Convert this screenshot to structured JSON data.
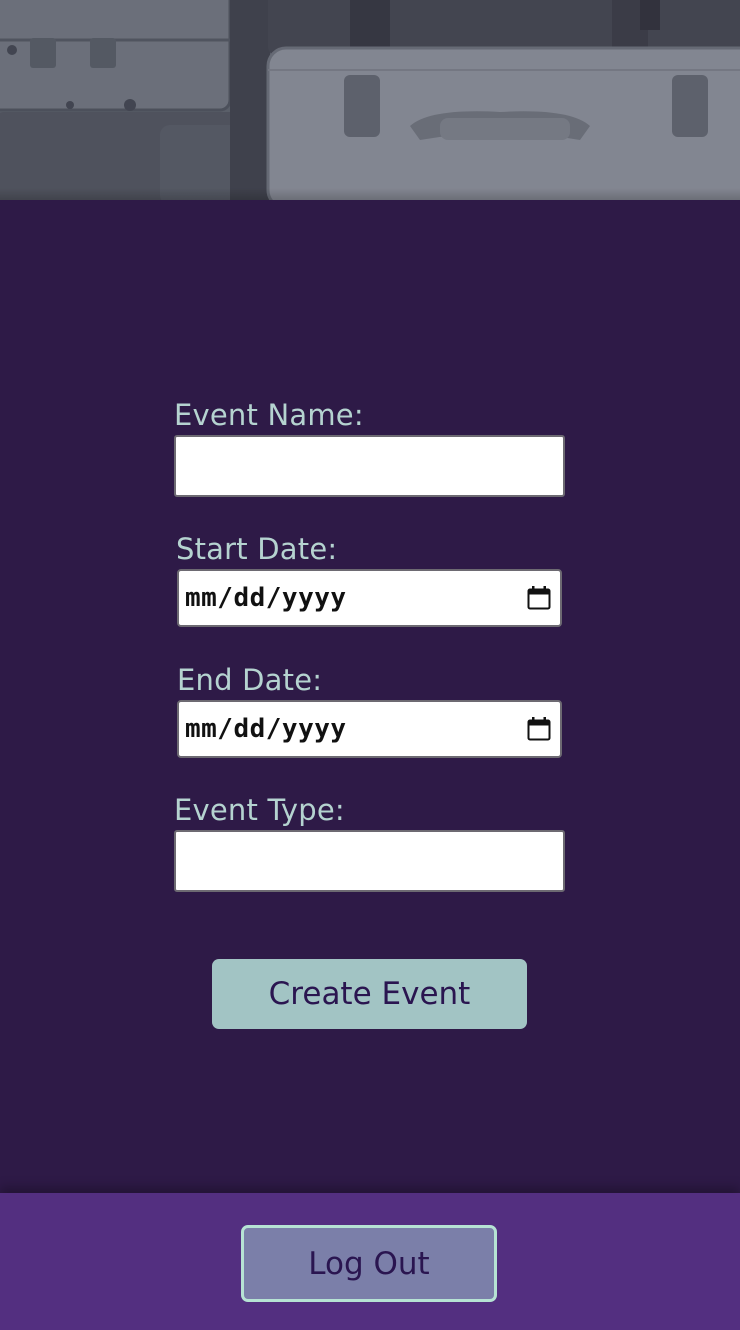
{
  "hero": {
    "image": "vintage-suitcases-photo"
  },
  "form": {
    "event_name": {
      "label": "Event Name:",
      "value": ""
    },
    "start_date": {
      "label": "Start Date:",
      "placeholder": "mm/dd/yyyy"
    },
    "end_date": {
      "label": "End Date:",
      "placeholder": "mm/dd/yyyy"
    },
    "event_type": {
      "label": "Event Type:",
      "value": ""
    },
    "submit_label": "Create Event"
  },
  "footer": {
    "logout_label": "Log Out"
  },
  "colors": {
    "background": "#2e1a47",
    "footer": "#532f80",
    "label": "#b5d3d0",
    "button": "#a2c4c4",
    "logout_button": "#7b7fa9",
    "logout_border": "#b6e3d4"
  }
}
